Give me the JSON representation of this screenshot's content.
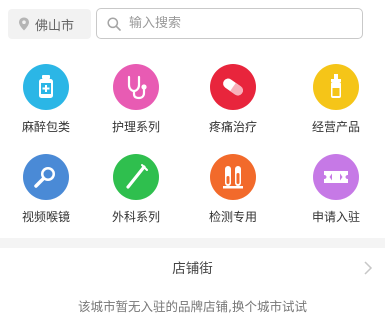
{
  "search": {
    "city": "佛山市",
    "placeholder": "输入搜索"
  },
  "categories": [
    {
      "label": "麻醉包类",
      "icon": "medicine-bottle-icon",
      "color": "#2bb6e6"
    },
    {
      "label": "护理系列",
      "icon": "stethoscope-icon",
      "color": "#e85bb3"
    },
    {
      "label": "疼痛治疗",
      "icon": "pill-capsule-icon",
      "color": "#e8253c"
    },
    {
      "label": "经营产品",
      "icon": "vial-icon",
      "color": "#f5c518"
    },
    {
      "label": "视频喉镜",
      "icon": "magnifier-icon",
      "color": "#4a8ad6"
    },
    {
      "label": "外科系列",
      "icon": "syringe-icon",
      "color": "#2fbf4e"
    },
    {
      "label": "检测专用",
      "icon": "test-tubes-icon",
      "color": "#f26a2b"
    },
    {
      "label": "申请入驻",
      "icon": "ticket-icon",
      "color": "#c679e6"
    }
  ],
  "shop_street": {
    "title": "店铺街",
    "empty_message": "该城市暂无入驻的品牌店铺,换个城市试试"
  }
}
